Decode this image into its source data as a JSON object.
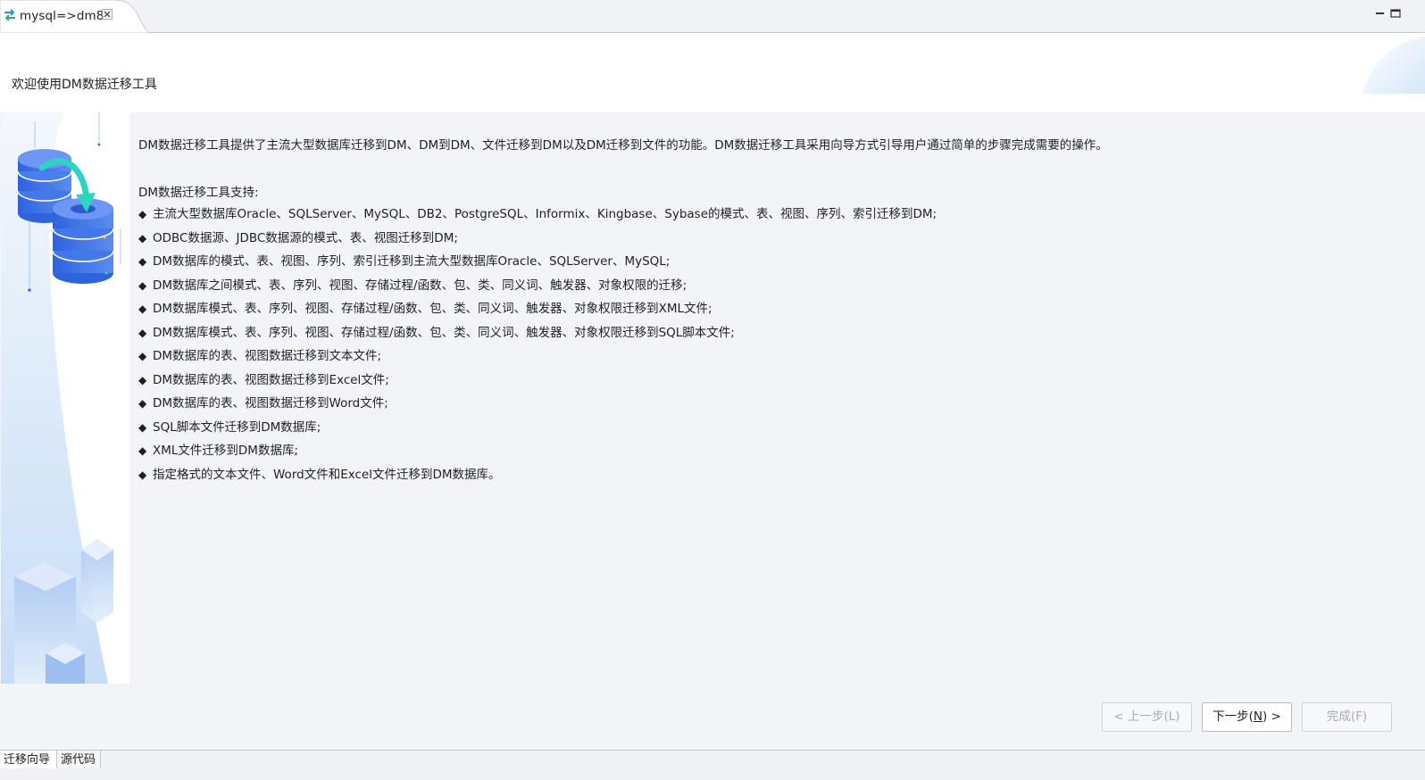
{
  "editor_tab": {
    "title": "mysql=>dm8",
    "icon": "migrate-arrows-icon",
    "close_icon": "close-icon"
  },
  "window_controls": [
    "minimize-icon",
    "maximize-icon"
  ],
  "header": {
    "title": "欢迎使用DM数据迁移工具"
  },
  "content": {
    "intro": "DM数据迁移工具提供了主流大型数据库迁移到DM、DM到DM、文件迁移到DM以及DM迁移到文件的功能。DM数据迁移工具采用向导方式引导用户通过简单的步骤完成需要的操作。",
    "support_title": "DM数据迁移工具支持:",
    "bullet": "◆",
    "items": [
      "主流大型数据库Oracle、SQLServer、MySQL、DB2、PostgreSQL、Informix、Kingbase、Sybase的模式、表、视图、序列、索引迁移到DM;",
      "ODBC数据源、JDBC数据源的模式、表、视图迁移到DM;",
      "DM数据库的模式、表、视图、序列、索引迁移到主流大型数据库Oracle、SQLServer、MySQL;",
      "DM数据库之间模式、表、序列、视图、存储过程/函数、包、类、同义词、触发器、对象权限的迁移;",
      "DM数据库模式、表、序列、视图、存储过程/函数、包、类、同义词、触发器、对象权限迁移到XML文件;",
      "DM数据库模式、表、序列、视图、存储过程/函数、包、类、同义词、触发器、对象权限迁移到SQL脚本文件;",
      "DM数据库的表、视图数据迁移到文本文件;",
      "DM数据库的表、视图数据迁移到Excel文件;",
      "DM数据库的表、视图数据迁移到Word文件;",
      "SQL脚本文件迁移到DM数据库;",
      "XML文件迁移到DM数据库;",
      "指定格式的文本文件、Word文件和Excel文件迁移到DM数据库。"
    ]
  },
  "buttons": {
    "back": "< 上一步(L)",
    "next_prefix": "下一步(",
    "next_mnemonic": "N",
    "next_suffix": ") >",
    "finish": "完成(F)"
  },
  "bottom_tabs": [
    "迁移向导",
    "源代码"
  ],
  "colors": {
    "background": "#f2f4f7",
    "header_bg": "#ffffff",
    "accent_blue": "#3b6fe0",
    "accent_teal": "#2fd3c4",
    "disabled_text": "#a8acb3"
  }
}
